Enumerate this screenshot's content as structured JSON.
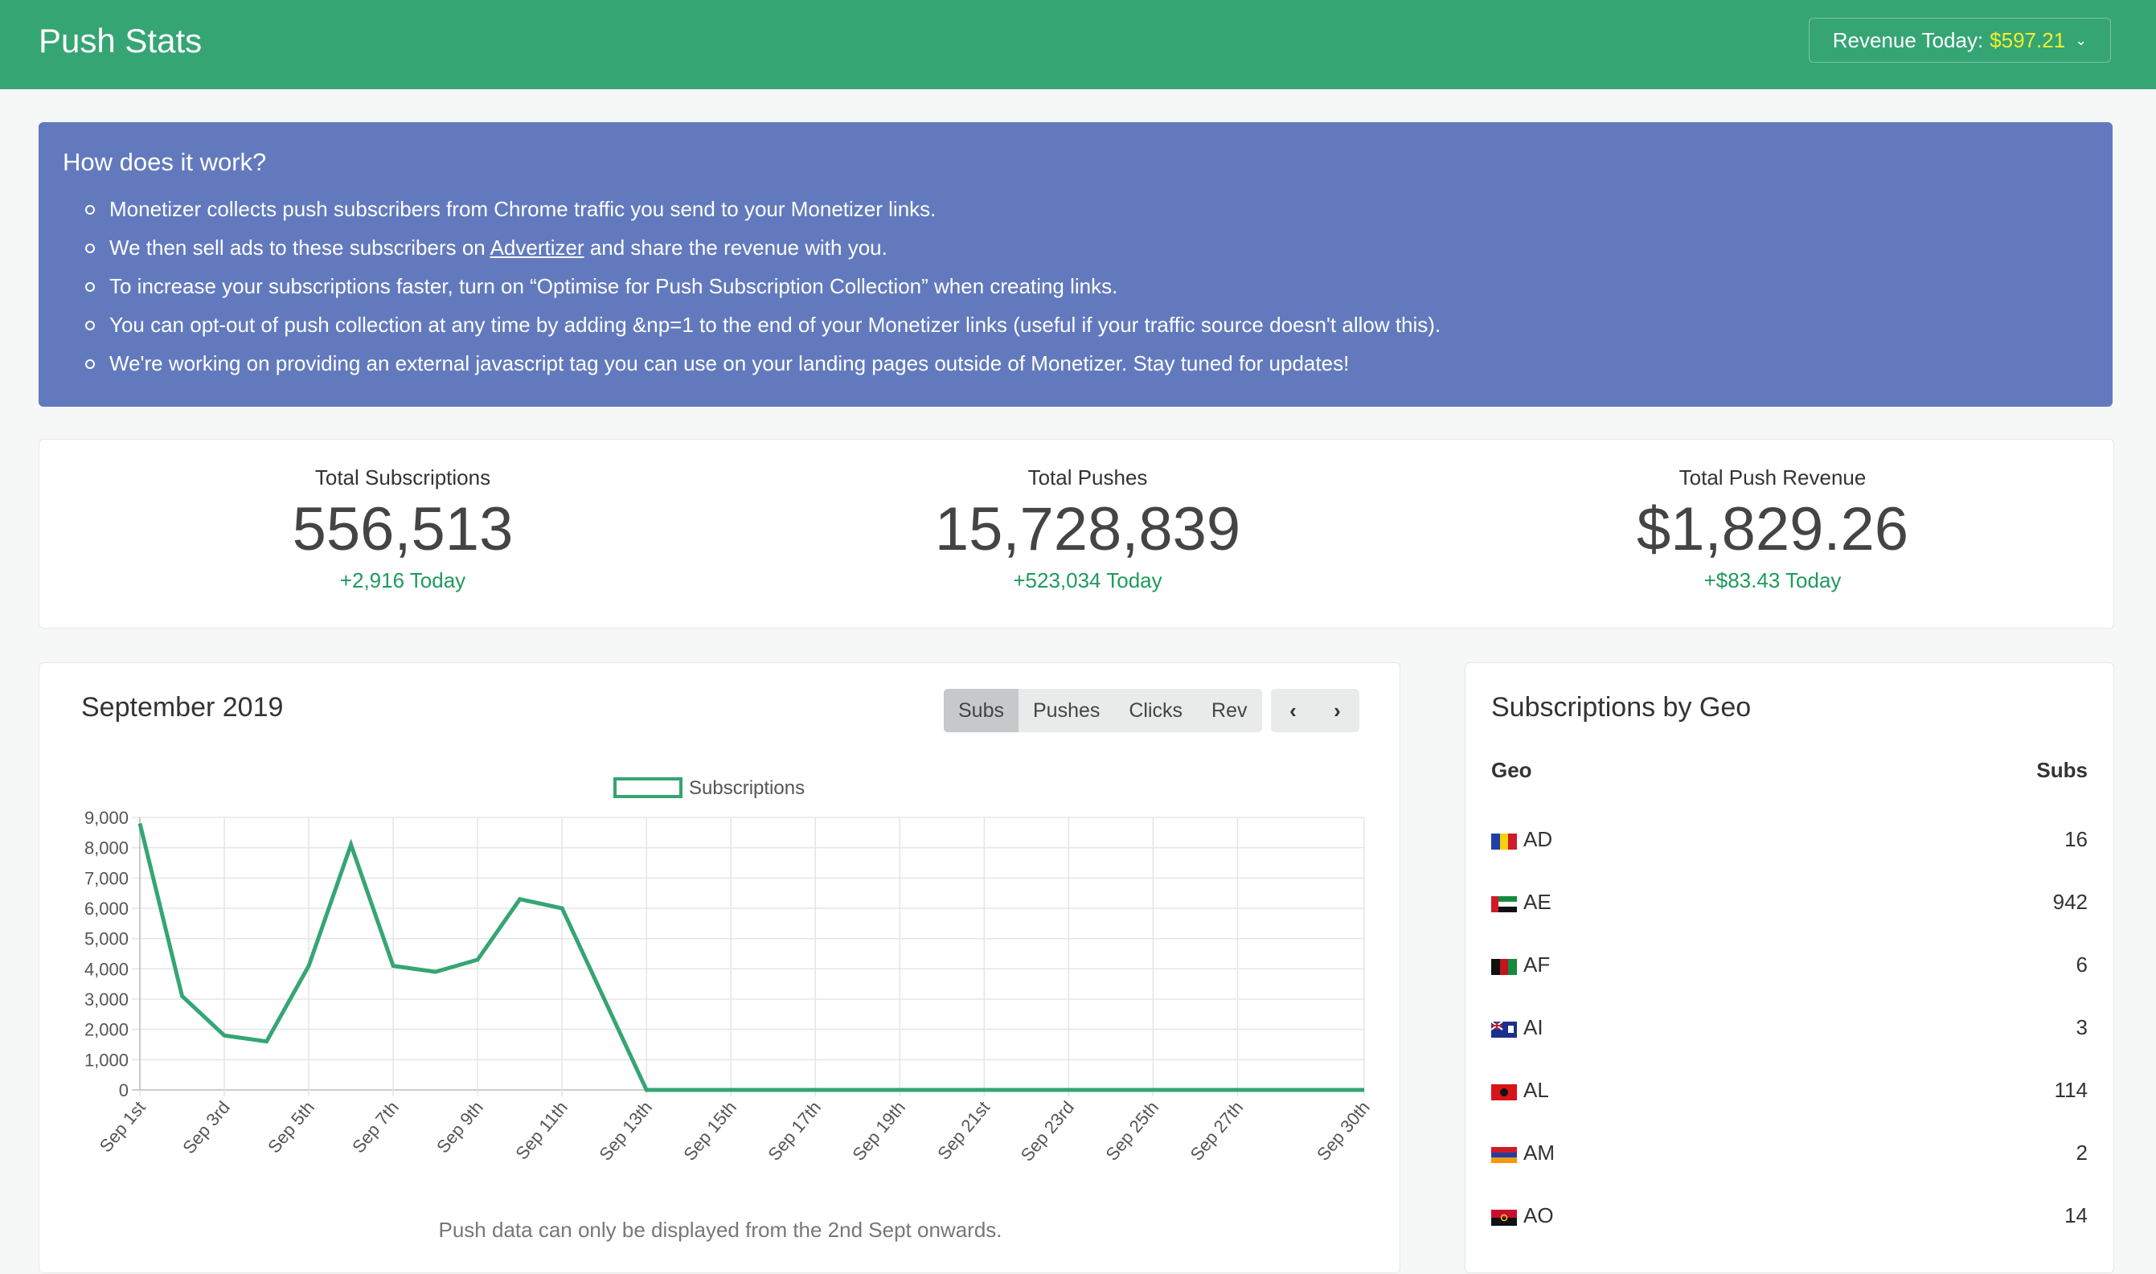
{
  "header": {
    "title": "Push Stats",
    "revenue_label": "Revenue Today:",
    "revenue_value": "$597.21"
  },
  "info": {
    "heading": "How does it work?",
    "items": [
      "Monetizer collects push subscribers from Chrome traffic you send to your Monetizer links.",
      "To increase your subscriptions faster, turn on “Optimise for Push Subscription Collection” when creating links.",
      "You can opt-out of push collection at any time by adding &np=1 to the end of your Monetizer links (useful if your traffic source doesn't allow this).",
      "We're working on providing an external javascript tag you can use on your landing pages outside of Monetizer. Stay tuned for updates!"
    ],
    "item2_before": "We then sell ads to these subscribers on ",
    "item2_link": "Advertizer",
    "item2_after": " and share the revenue with you."
  },
  "stats": [
    {
      "label": "Total Subscriptions",
      "value": "556,513",
      "delta": "+2,916 Today"
    },
    {
      "label": "Total Pushes",
      "value": "15,728,839",
      "delta": "+523,034 Today"
    },
    {
      "label": "Total Push Revenue",
      "value": "$1,829.26",
      "delta": "+$83.43 Today"
    }
  ],
  "chart_panel": {
    "title": "September 2019",
    "tabs": [
      "Subs",
      "Pushes",
      "Clicks",
      "Rev"
    ],
    "active_tab": "Subs",
    "prev_icon": "chevron-left-icon",
    "next_icon": "chevron-right-icon",
    "note": "Push data can only be displayed from the 2nd Sept onwards."
  },
  "chart_data": {
    "type": "line",
    "series": [
      {
        "name": "Subscriptions",
        "color": "#35a574",
        "values": [
          8800,
          3100,
          1800,
          1600,
          4100,
          8100,
          4100,
          3900,
          4300,
          6300,
          6000,
          3000,
          0,
          0,
          0,
          0,
          0,
          0,
          0,
          0,
          0,
          0,
          0,
          0,
          0,
          0,
          0,
          0,
          0,
          0
        ]
      }
    ],
    "x": [
      "Sep 1st",
      "Sep 2nd",
      "Sep 3rd",
      "Sep 4th",
      "Sep 5th",
      "Sep 6th",
      "Sep 7th",
      "Sep 8th",
      "Sep 9th",
      "Sep 10th",
      "Sep 11th",
      "Sep 12th",
      "Sep 13th",
      "Sep 14th",
      "Sep 15th",
      "Sep 16th",
      "Sep 17th",
      "Sep 18th",
      "Sep 19th",
      "Sep 20th",
      "Sep 21st",
      "Sep 22nd",
      "Sep 23rd",
      "Sep 24th",
      "Sep 25th",
      "Sep 26th",
      "Sep 27th",
      "Sep 28th",
      "Sep 29th",
      "Sep 30th"
    ],
    "shown_x_labels": [
      "Sep 1st",
      "Sep 3rd",
      "Sep 5th",
      "Sep 7th",
      "Sep 9th",
      "Sep 11th",
      "Sep 13th",
      "Sep 15th",
      "Sep 17th",
      "Sep 19th",
      "Sep 21st",
      "Sep 23rd",
      "Sep 25th",
      "Sep 27th",
      "Sep 30th"
    ],
    "yticks": [
      "0",
      "1,000",
      "2,000",
      "3,000",
      "4,000",
      "5,000",
      "6,000",
      "7,000",
      "8,000",
      "9,000"
    ],
    "ylim": [
      0,
      9000
    ],
    "grid": true,
    "legend": "top-center"
  },
  "geo": {
    "title": "Subscriptions by Geo",
    "col_geo": "Geo",
    "col_subs": "Subs",
    "rows": [
      {
        "code": "AD",
        "subs": "16",
        "flag": "andorra-flag-icon"
      },
      {
        "code": "AE",
        "subs": "942",
        "flag": "uae-flag-icon"
      },
      {
        "code": "AF",
        "subs": "6",
        "flag": "afghanistan-flag-icon"
      },
      {
        "code": "AI",
        "subs": "3",
        "flag": "anguilla-flag-icon"
      },
      {
        "code": "AL",
        "subs": "114",
        "flag": "albania-flag-icon"
      },
      {
        "code": "AM",
        "subs": "2",
        "flag": "armenia-flag-icon"
      },
      {
        "code": "AO",
        "subs": "14",
        "flag": "angola-flag-icon"
      }
    ]
  }
}
